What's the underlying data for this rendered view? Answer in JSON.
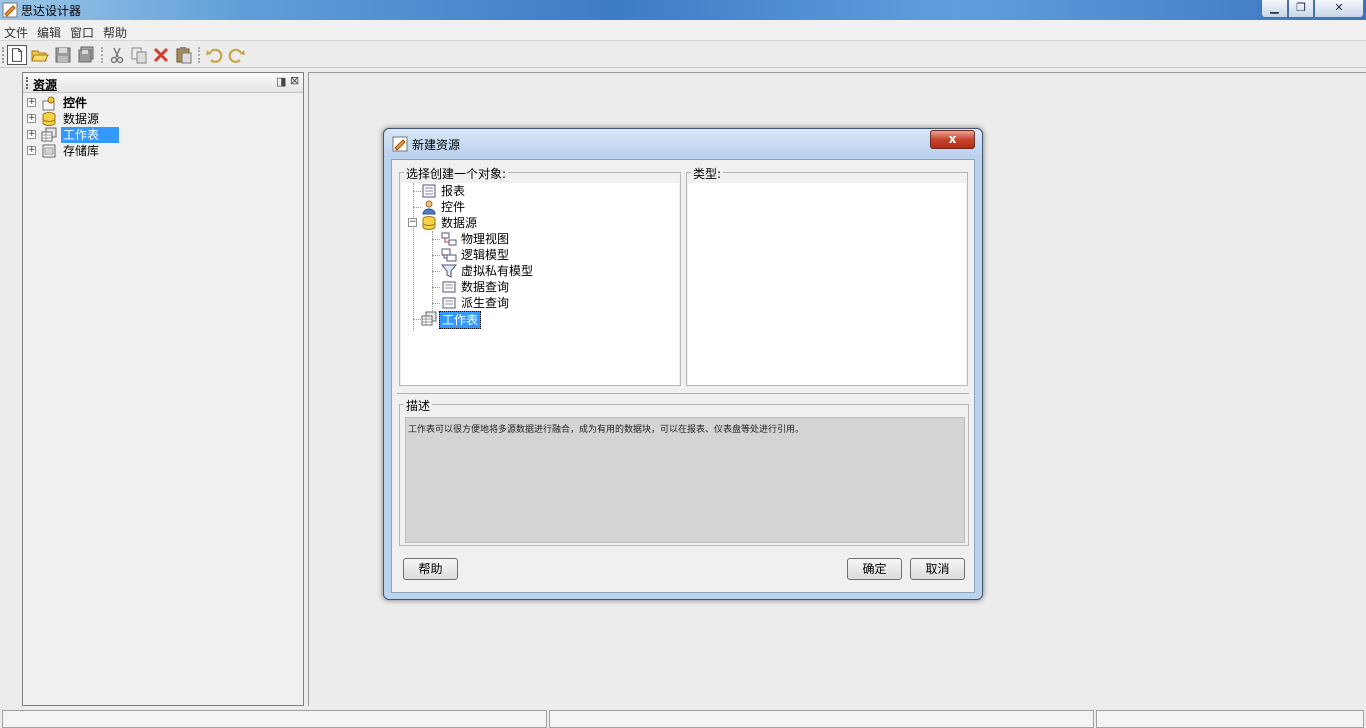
{
  "window": {
    "title": "思达设计器",
    "minimize_icon": "minimize-icon",
    "maximize_icon": "restore-icon",
    "close_icon": "close-icon",
    "min_glyph": "▁",
    "max_glyph": "❐",
    "close_glyph": "✕"
  },
  "menu": {
    "file": "文件",
    "edit": "编辑",
    "window": "窗口",
    "help": "帮助"
  },
  "toolbar": {
    "items": [
      "new-file-icon",
      "open-folder-icon",
      "save-icon",
      "save-all-icon",
      "cut-icon",
      "copy-icon",
      "delete-icon",
      "paste-icon",
      "undo-icon",
      "redo-icon"
    ]
  },
  "resource_panel": {
    "title": "资源",
    "pin_glyph": "◨",
    "close_glyph": "⊠",
    "items": [
      {
        "label": "控件",
        "expander": "+",
        "bold": true
      },
      {
        "label": "数据源",
        "expander": "+"
      },
      {
        "label": "工作表",
        "expander": "+",
        "selected": true
      },
      {
        "label": "存储库",
        "expander": "+"
      }
    ]
  },
  "dialog": {
    "title": "新建资源",
    "close_glyph": "x",
    "select_object_legend": "选择创建一个对象:",
    "type_legend": "类型:",
    "tree": [
      {
        "label": "报表"
      },
      {
        "label": "控件"
      },
      {
        "label": "数据源",
        "expander": "−"
      },
      {
        "label": "物理视图"
      },
      {
        "label": "逻辑模型"
      },
      {
        "label": "虚拟私有模型"
      },
      {
        "label": "数据查询"
      },
      {
        "label": "派生查询"
      },
      {
        "label": "工作表",
        "selected": true
      }
    ],
    "description_legend": "描述",
    "description_text": "工作表可以很方便地将多源数据进行融合，成为有用的数据块，可以在报表、仪表盘等处进行引用。",
    "help_button": "帮助",
    "ok_button": "确定",
    "cancel_button": "取消"
  },
  "colors": {
    "selection": "#3399ff",
    "title_gradient_mid": "#3d7cc6",
    "dialog_frame": "#bcd3ee",
    "close_red": "#c6442d"
  }
}
